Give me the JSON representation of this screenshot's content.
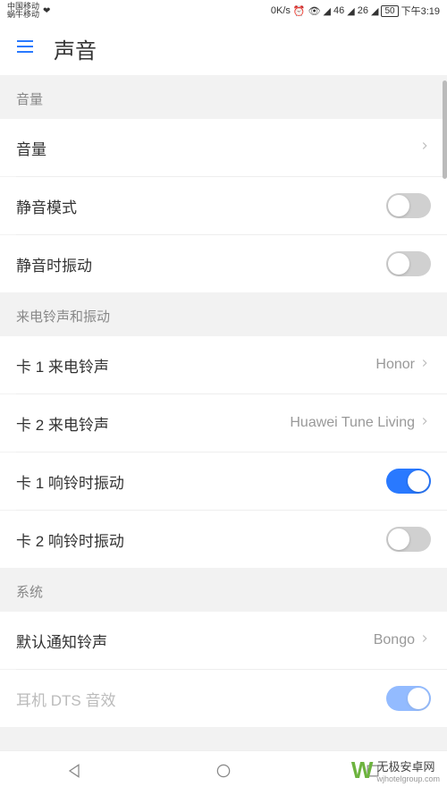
{
  "status": {
    "carrier1": "中国移动",
    "carrier2": "蜗牛移动",
    "speed": "0K/s",
    "net": "46",
    "sig": "26",
    "battery": "50",
    "time": "下午3:19"
  },
  "header": {
    "title": "声音"
  },
  "sections": {
    "volume": {
      "header": "音量",
      "volume_label": "音量",
      "silent_mode": "静音模式",
      "vibrate_silent": "静音时振动"
    },
    "ringtone": {
      "header": "来电铃声和振动",
      "sim1_ring": "卡 1 来电铃声",
      "sim1_val": "Honor",
      "sim2_ring": "卡 2 来电铃声",
      "sim2_val": "Huawei Tune Living",
      "sim1_vib": "卡 1 响铃时振动",
      "sim2_vib": "卡 2 响铃时振动"
    },
    "system": {
      "header": "系统",
      "default_notif": "默认通知铃声",
      "default_notif_val": "Bongo",
      "dts": "耳机 DTS 音效"
    }
  },
  "watermark": {
    "brand": "无极安卓网",
    "url": "wjhotelgroup.com"
  }
}
